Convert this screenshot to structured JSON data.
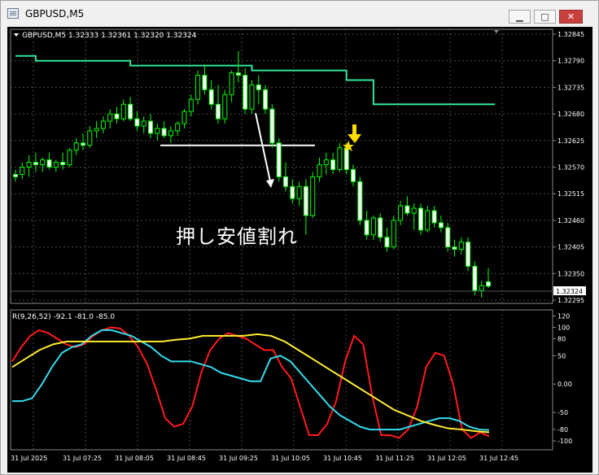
{
  "window": {
    "title": "GBPUSD,M5",
    "buttons": {
      "minimize": "▁",
      "maximize": "□",
      "close": "✕"
    }
  },
  "chart_header": {
    "symbol_info": "GBPUSD,M5  1.32333 1.32361 1.32320 1.32324"
  },
  "annotation_text": "押し安値割れ",
  "price_axis": {
    "labels": [
      "1.32845",
      "1.32790",
      "1.32735",
      "1.32680",
      "1.32625",
      "1.32570",
      "1.32515",
      "1.32460",
      "1.32405",
      "1.32350",
      "1.32295"
    ],
    "current_price": "1.32324"
  },
  "indicator": {
    "label": "R(9,26,52) -92.1 -81.0 -85.0",
    "axis_labels": [
      "120",
      "100",
      "80",
      "50",
      "0.00",
      "-50",
      "-80",
      "-100"
    ]
  },
  "time_axis": {
    "labels": [
      "31 Jul 2025",
      "31 Jul 07:25",
      "31 Jul 08:05",
      "31 Jul 08:45",
      "31 Jul 09:25",
      "31 Jul 10:05",
      "31 Jul 10:45",
      "31 Jul 11:25",
      "31 Jul 12:05",
      "31 Jul 12:45"
    ]
  },
  "colors": {
    "background": "#000000",
    "grid": "#4a4a4a",
    "candle": "#00ff00",
    "band": "#33e699",
    "red_line": "#ff1a1a",
    "cyan_line": "#33ddf0",
    "yellow_line": "#ffee33",
    "marker": "#ffdd00"
  },
  "icons": {
    "collapse": "triangle-down-icon",
    "arrow": "arrow-down-icon",
    "star": "star-icon"
  },
  "chart_data": {
    "type": "candlestick",
    "candles": [
      {
        "o": 1.32555,
        "h": 1.32565,
        "l": 1.3254,
        "c": 1.3255
      },
      {
        "o": 1.32555,
        "h": 1.3258,
        "l": 1.32545,
        "c": 1.3257
      },
      {
        "o": 1.3257,
        "h": 1.32595,
        "l": 1.3255,
        "c": 1.3258
      },
      {
        "o": 1.3258,
        "h": 1.326,
        "l": 1.3256,
        "c": 1.32575
      },
      {
        "o": 1.32575,
        "h": 1.3259,
        "l": 1.3256,
        "c": 1.32585
      },
      {
        "o": 1.32585,
        "h": 1.326,
        "l": 1.32565,
        "c": 1.3257
      },
      {
        "o": 1.3257,
        "h": 1.32585,
        "l": 1.3256,
        "c": 1.3258
      },
      {
        "o": 1.3258,
        "h": 1.326,
        "l": 1.32565,
        "c": 1.32575
      },
      {
        "o": 1.32575,
        "h": 1.3261,
        "l": 1.3257,
        "c": 1.32605
      },
      {
        "o": 1.32605,
        "h": 1.3263,
        "l": 1.32595,
        "c": 1.3262
      },
      {
        "o": 1.3262,
        "h": 1.3264,
        "l": 1.32605,
        "c": 1.32615
      },
      {
        "o": 1.32615,
        "h": 1.32655,
        "l": 1.3261,
        "c": 1.32645
      },
      {
        "o": 1.32645,
        "h": 1.32665,
        "l": 1.3263,
        "c": 1.3265
      },
      {
        "o": 1.3265,
        "h": 1.32675,
        "l": 1.3264,
        "c": 1.32665
      },
      {
        "o": 1.32665,
        "h": 1.3269,
        "l": 1.3265,
        "c": 1.3268
      },
      {
        "o": 1.3268,
        "h": 1.32695,
        "l": 1.3266,
        "c": 1.3267
      },
      {
        "o": 1.3267,
        "h": 1.3271,
        "l": 1.32665,
        "c": 1.327
      },
      {
        "o": 1.327,
        "h": 1.32715,
        "l": 1.32665,
        "c": 1.3267
      },
      {
        "o": 1.3267,
        "h": 1.32685,
        "l": 1.32645,
        "c": 1.32655
      },
      {
        "o": 1.32655,
        "h": 1.32675,
        "l": 1.3264,
        "c": 1.32665
      },
      {
        "o": 1.32665,
        "h": 1.3268,
        "l": 1.3263,
        "c": 1.3264
      },
      {
        "o": 1.3264,
        "h": 1.3266,
        "l": 1.32625,
        "c": 1.3265
      },
      {
        "o": 1.3265,
        "h": 1.32665,
        "l": 1.3263,
        "c": 1.32635
      },
      {
        "o": 1.32635,
        "h": 1.32655,
        "l": 1.3262,
        "c": 1.32645
      },
      {
        "o": 1.32645,
        "h": 1.32665,
        "l": 1.32635,
        "c": 1.3266
      },
      {
        "o": 1.3266,
        "h": 1.3269,
        "l": 1.3265,
        "c": 1.32685
      },
      {
        "o": 1.32685,
        "h": 1.3272,
        "l": 1.32675,
        "c": 1.3271
      },
      {
        "o": 1.3271,
        "h": 1.3277,
        "l": 1.327,
        "c": 1.3276
      },
      {
        "o": 1.3276,
        "h": 1.3278,
        "l": 1.3272,
        "c": 1.3273
      },
      {
        "o": 1.3273,
        "h": 1.3275,
        "l": 1.3269,
        "c": 1.327
      },
      {
        "o": 1.327,
        "h": 1.3274,
        "l": 1.3266,
        "c": 1.3267
      },
      {
        "o": 1.3267,
        "h": 1.3273,
        "l": 1.3266,
        "c": 1.3272
      },
      {
        "o": 1.3272,
        "h": 1.3277,
        "l": 1.32705,
        "c": 1.32765
      },
      {
        "o": 1.32765,
        "h": 1.3281,
        "l": 1.32745,
        "c": 1.3276
      },
      {
        "o": 1.3276,
        "h": 1.32775,
        "l": 1.3268,
        "c": 1.3269
      },
      {
        "o": 1.3269,
        "h": 1.3275,
        "l": 1.3268,
        "c": 1.3274
      },
      {
        "o": 1.3274,
        "h": 1.3276,
        "l": 1.327,
        "c": 1.3273
      },
      {
        "o": 1.3273,
        "h": 1.3274,
        "l": 1.3268,
        "c": 1.3269
      },
      {
        "o": 1.3269,
        "h": 1.327,
        "l": 1.3261,
        "c": 1.3262
      },
      {
        "o": 1.3262,
        "h": 1.3263,
        "l": 1.3254,
        "c": 1.3255
      },
      {
        "o": 1.3255,
        "h": 1.3258,
        "l": 1.3252,
        "c": 1.3253
      },
      {
        "o": 1.3253,
        "h": 1.32545,
        "l": 1.32495,
        "c": 1.32505
      },
      {
        "o": 1.32505,
        "h": 1.3254,
        "l": 1.3249,
        "c": 1.3253
      },
      {
        "o": 1.3253,
        "h": 1.32545,
        "l": 1.3243,
        "c": 1.3247
      },
      {
        "o": 1.3247,
        "h": 1.3256,
        "l": 1.32465,
        "c": 1.3255
      },
      {
        "o": 1.3255,
        "h": 1.3259,
        "l": 1.3254,
        "c": 1.32575
      },
      {
        "o": 1.32575,
        "h": 1.326,
        "l": 1.32555,
        "c": 1.32585
      },
      {
        "o": 1.32585,
        "h": 1.326,
        "l": 1.32555,
        "c": 1.32565
      },
      {
        "o": 1.32565,
        "h": 1.3262,
        "l": 1.3256,
        "c": 1.3261
      },
      {
        "o": 1.3261,
        "h": 1.3262,
        "l": 1.32555,
        "c": 1.32565
      },
      {
        "o": 1.32565,
        "h": 1.32575,
        "l": 1.3253,
        "c": 1.3254
      },
      {
        "o": 1.3254,
        "h": 1.3255,
        "l": 1.3245,
        "c": 1.3246
      },
      {
        "o": 1.3246,
        "h": 1.3248,
        "l": 1.3242,
        "c": 1.3243
      },
      {
        "o": 1.3243,
        "h": 1.3247,
        "l": 1.3242,
        "c": 1.32465
      },
      {
        "o": 1.32465,
        "h": 1.32475,
        "l": 1.32415,
        "c": 1.32425
      },
      {
        "o": 1.32425,
        "h": 1.32445,
        "l": 1.32395,
        "c": 1.32405
      },
      {
        "o": 1.32405,
        "h": 1.3247,
        "l": 1.324,
        "c": 1.3246
      },
      {
        "o": 1.3246,
        "h": 1.325,
        "l": 1.3245,
        "c": 1.3249
      },
      {
        "o": 1.3249,
        "h": 1.3251,
        "l": 1.3247,
        "c": 1.32475
      },
      {
        "o": 1.32475,
        "h": 1.32495,
        "l": 1.3244,
        "c": 1.32485
      },
      {
        "o": 1.32485,
        "h": 1.32495,
        "l": 1.3243,
        "c": 1.3244
      },
      {
        "o": 1.3244,
        "h": 1.3249,
        "l": 1.32435,
        "c": 1.3248
      },
      {
        "o": 1.3248,
        "h": 1.3249,
        "l": 1.32445,
        "c": 1.32455
      },
      {
        "o": 1.32455,
        "h": 1.3247,
        "l": 1.32435,
        "c": 1.32445
      },
      {
        "o": 1.32445,
        "h": 1.32455,
        "l": 1.32395,
        "c": 1.32405
      },
      {
        "o": 1.32405,
        "h": 1.3242,
        "l": 1.32385,
        "c": 1.324
      },
      {
        "o": 1.324,
        "h": 1.32425,
        "l": 1.3239,
        "c": 1.32415
      },
      {
        "o": 1.32415,
        "h": 1.32425,
        "l": 1.32355,
        "c": 1.32365
      },
      {
        "o": 1.32365,
        "h": 1.32375,
        "l": 1.32305,
        "c": 1.32315
      },
      {
        "o": 1.32315,
        "h": 1.32335,
        "l": 1.323,
        "c": 1.32325
      },
      {
        "o": 1.32333,
        "h": 1.32361,
        "l": 1.3232,
        "c": 1.32324
      }
    ],
    "band_line": [
      1.328,
      1.328,
      1.328,
      1.3279,
      1.3279,
      1.3279,
      1.3279,
      1.3279,
      1.3279,
      1.3279,
      1.3279,
      1.3279,
      1.3279,
      1.3279,
      1.3279,
      1.3279,
      1.3279,
      1.3278,
      1.3278,
      1.3278,
      1.3278,
      1.3278,
      1.3278,
      1.3278,
      1.3278,
      1.3278,
      1.3278,
      1.3278,
      1.3278,
      1.3278,
      1.3278,
      1.3278,
      1.3278,
      1.3278,
      1.3278,
      1.3277,
      1.3277,
      1.3277,
      1.3277,
      1.3277,
      1.3277,
      1.3277,
      1.3277,
      1.3277,
      1.3277,
      1.3277,
      1.3277,
      1.3277,
      1.3277,
      1.3275,
      1.3275,
      1.3275,
      1.3275,
      1.327,
      1.327,
      1.327,
      1.327,
      1.327,
      1.327,
      1.327,
      1.327,
      1.327,
      1.327,
      1.327,
      1.327,
      1.327,
      1.327,
      1.327,
      1.327,
      1.327,
      1.327,
      1.327
    ],
    "horizontal_line": 1.32615,
    "indicator_ylim": [
      -110,
      125
    ],
    "series": [
      {
        "name": "R9",
        "values": [
          40,
          65,
          85,
          95,
          90,
          80,
          70,
          65,
          70,
          85,
          95,
          100,
          98,
          85,
          65,
          35,
          -10,
          -60,
          -75,
          -70,
          -40,
          20,
          60,
          80,
          90,
          85,
          80,
          70,
          60,
          60,
          30,
          10,
          -40,
          -90,
          -90,
          -70,
          -30,
          40,
          85,
          70,
          -20,
          -90,
          -90,
          -95,
          -80,
          -40,
          30,
          55,
          50,
          0,
          -80,
          -95,
          -85,
          -92
        ]
      },
      {
        "name": "R26",
        "values": [
          -30,
          -30,
          -25,
          0,
          30,
          55,
          65,
          70,
          85,
          95,
          95,
          90,
          85,
          75,
          65,
          50,
          40,
          40,
          40,
          35,
          30,
          20,
          15,
          10,
          5,
          5,
          45,
          50,
          40,
          20,
          0,
          -20,
          -40,
          -55,
          -65,
          -75,
          -80,
          -80,
          -80,
          -80,
          -75,
          -70,
          -65,
          -60,
          -60,
          -65,
          -75,
          -80,
          -81
        ]
      },
      {
        "name": "R52",
        "values": [
          30,
          45,
          60,
          70,
          75,
          75,
          75,
          75,
          75,
          75,
          75,
          75,
          78,
          80,
          85,
          85,
          85,
          85,
          88,
          85,
          75,
          60,
          45,
          30,
          15,
          0,
          -15,
          -30,
          -45,
          -55,
          -65,
          -72,
          -78,
          -80,
          -83,
          -85
        ]
      }
    ]
  }
}
